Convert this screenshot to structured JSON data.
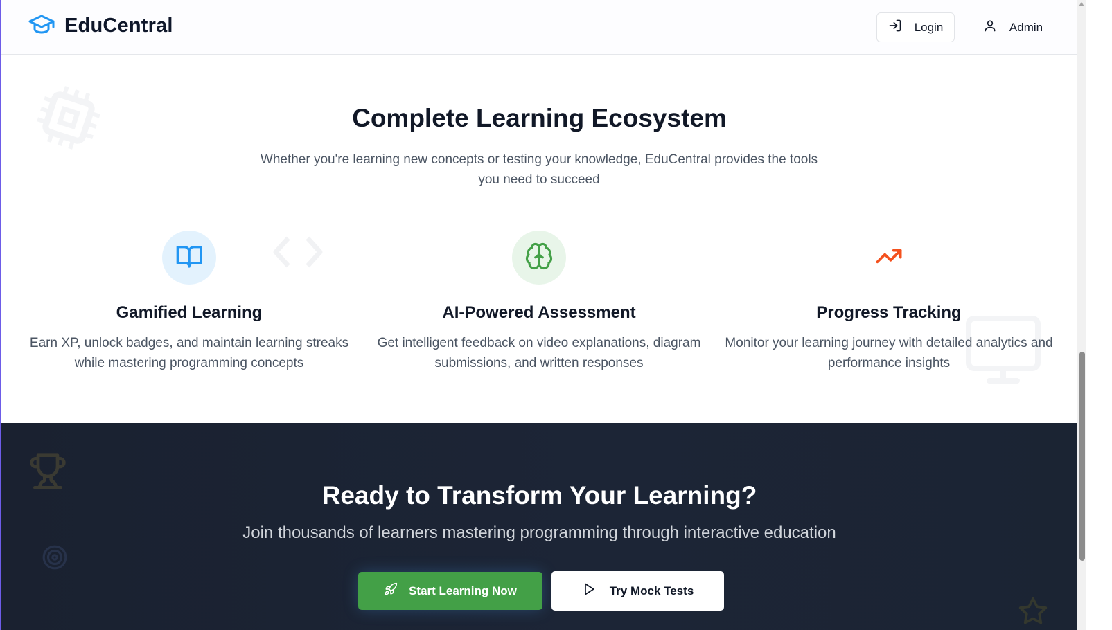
{
  "header": {
    "brand_name": "EduCentral",
    "logo_icon": "graduation-cap-icon",
    "login_label": "Login",
    "admin_label": "Admin"
  },
  "ecosystem": {
    "title": "Complete Learning Ecosystem",
    "subtitle": "Whether you're learning new concepts or testing your knowledge, EduCentral provides the tools you need to succeed",
    "features": [
      {
        "icon": "book-open-icon",
        "title": "Gamified Learning",
        "description": "Earn XP, unlock badges, and maintain learning streaks while mastering programming concepts",
        "color": "#2196f3"
      },
      {
        "icon": "brain-icon",
        "title": "AI-Powered Assessment",
        "description": "Get intelligent feedback on video explanations, diagram submissions, and written responses",
        "color": "#43a047"
      },
      {
        "icon": "trending-up-icon",
        "title": "Progress Tracking",
        "description": "Monitor your learning journey with detailed analytics and performance insights",
        "color": "#f4511e"
      }
    ]
  },
  "cta": {
    "title": "Ready to Transform Your Learning?",
    "subtitle": "Join thousands of learners mastering programming through interactive education",
    "start_label": "Start Learning Now",
    "mock_label": "Try Mock Tests"
  },
  "colors": {
    "accent_blue": "#2196f3",
    "accent_green": "#43a047",
    "accent_orange": "#f4511e",
    "dark_bg": "#1c2536"
  }
}
